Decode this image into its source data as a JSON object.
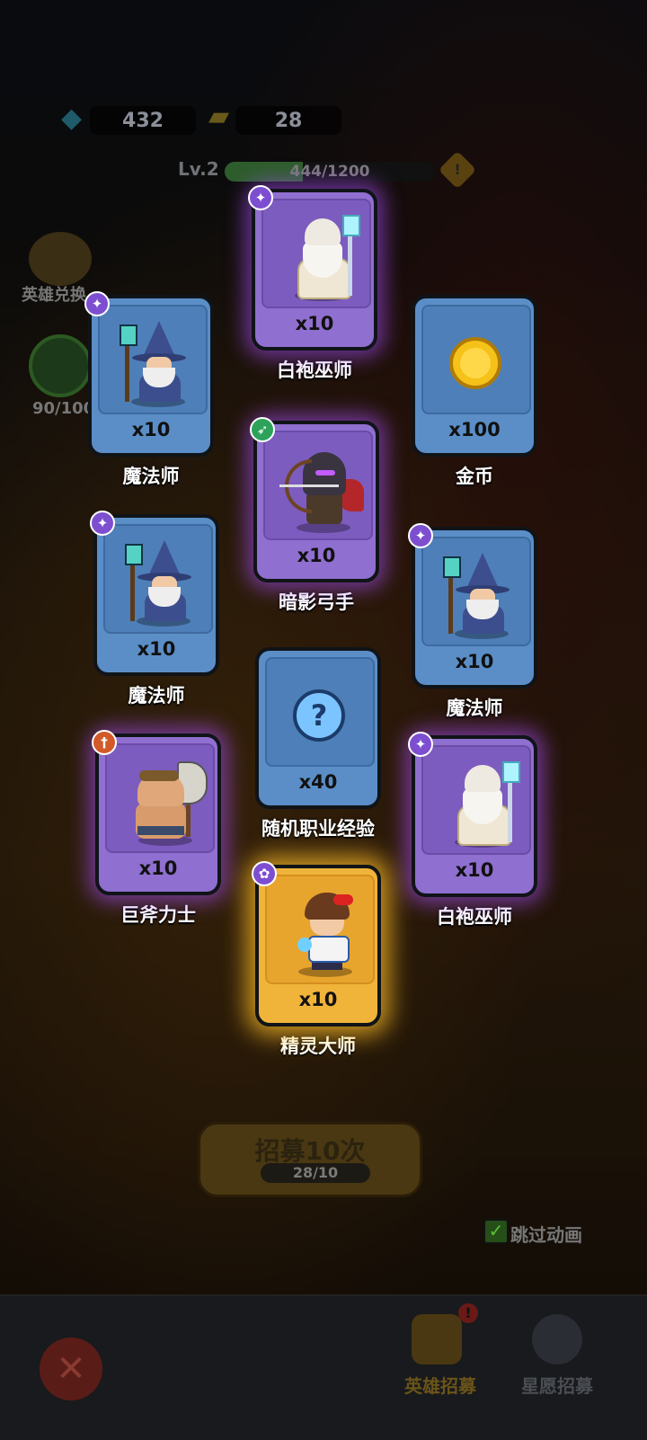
{
  "resources": {
    "gems": "432",
    "tickets": "28"
  },
  "level": {
    "label": "Lv.2",
    "xp_text": "444/1200",
    "xp_progress": 0.37,
    "warning": "!"
  },
  "side": {
    "hero_exchange_label": "英雄兑换",
    "star_progress": "90/100"
  },
  "cards": [
    {
      "name": "白袍巫师",
      "qty": "x10",
      "rarity": "purple",
      "badge": "magic"
    },
    {
      "name": "魔法师",
      "qty": "x10",
      "rarity": "blue",
      "badge": "magic"
    },
    {
      "name": "金币",
      "qty": "x100",
      "rarity": "blue",
      "badge": ""
    },
    {
      "name": "暗影弓手",
      "qty": "x10",
      "rarity": "purple",
      "badge": "archer"
    },
    {
      "name": "魔法师",
      "qty": "x10",
      "rarity": "blue",
      "badge": "magic"
    },
    {
      "name": "魔法师",
      "qty": "x10",
      "rarity": "blue",
      "badge": "magic"
    },
    {
      "name": "随机职业经验",
      "qty": "x40",
      "rarity": "blue",
      "badge": ""
    },
    {
      "name": "巨斧力士",
      "qty": "x10",
      "rarity": "purple",
      "badge": "warrior"
    },
    {
      "name": "白袍巫师",
      "qty": "x10",
      "rarity": "purple",
      "badge": "magic"
    },
    {
      "name": "精灵大师",
      "qty": "x10",
      "rarity": "gold",
      "badge": "beast"
    }
  ],
  "recruit": {
    "button_label": "招募10次",
    "count": "28/10"
  },
  "skip_animation": {
    "label": "跳过动画",
    "checked": true
  },
  "tabs": {
    "hero_recruit": "英雄招募",
    "star_recruit": "星愿招募",
    "alert": "!"
  },
  "colors": {
    "blue_card": "#5b8ec7",
    "purple_card": "#8f6fcf",
    "gold_card": "#f0b43a"
  }
}
